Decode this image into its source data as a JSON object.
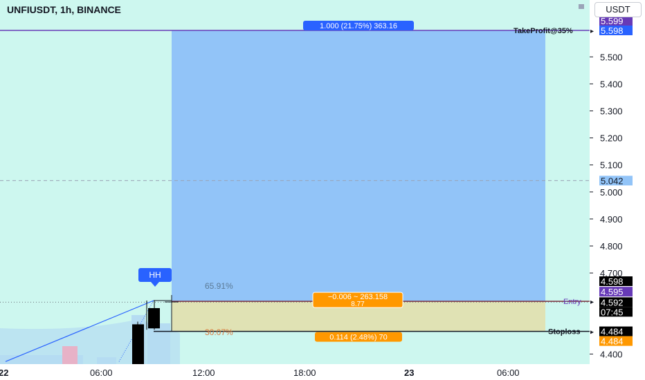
{
  "header": {
    "title": "UNFIUSDT, 1h, BINANCE",
    "currency": "USDT"
  },
  "colors": {
    "pane_bg": "#cdf7ef",
    "profit_zone": "#92c4f8",
    "loss_zone": "#e0e2b4",
    "blue_label": "#2962ff",
    "orange_label": "#ff9800",
    "purple_label": "#673ab7",
    "black_label": "#000000",
    "volume": "#b5dcf2",
    "volume_red": "#e7b2c7"
  },
  "y_axis": {
    "min": 4.36,
    "max": 5.66,
    "ticks": [
      "5.500",
      "5.400",
      "5.300",
      "5.200",
      "5.100",
      "5.000",
      "4.900",
      "4.800",
      "4.700",
      "4.400"
    ]
  },
  "x_axis": {
    "ticks": [
      "22",
      "06:00",
      "12:00",
      "18:00",
      "23",
      "06:00"
    ]
  },
  "price_labels": {
    "tp_top": "5.599",
    "tp_price": "5.598",
    "crosshair": "5.042",
    "high": "4.598",
    "entry_purple": "4.595",
    "last_price": "4.592",
    "countdown": "07:45",
    "stop_black": "4.484",
    "stop_orange": "4.484"
  },
  "position": {
    "tp_label": "1.000 (21.75%) 363.16",
    "entry_pnl": "−0.006 ~ 263.158",
    "entry_qty": "8.77",
    "stop_label": "0.114 (2.48%) 70",
    "tp_pct": "65.91%",
    "sl_pct": "30.07%"
  },
  "lines": {
    "take_profit": "TakeProfit@35%",
    "entry": "Entry",
    "stoploss": "Stoploss"
  },
  "marker": {
    "hh": "HH"
  },
  "chart_data": {
    "type": "candlestick",
    "title": "UNFIUSDT, 1h, BINANCE",
    "ylim": [
      4.36,
      5.66
    ],
    "candles": [
      {
        "open": 4.4,
        "high": 4.52,
        "low": 4.4,
        "close": 4.51,
        "dir": "up"
      },
      {
        "open": 4.51,
        "high": 4.598,
        "low": 4.49,
        "close": 4.57,
        "dir": "up"
      },
      {
        "open": 4.57,
        "high": 4.598,
        "low": 4.49,
        "close": 4.57,
        "dir": "down"
      }
    ]
  }
}
